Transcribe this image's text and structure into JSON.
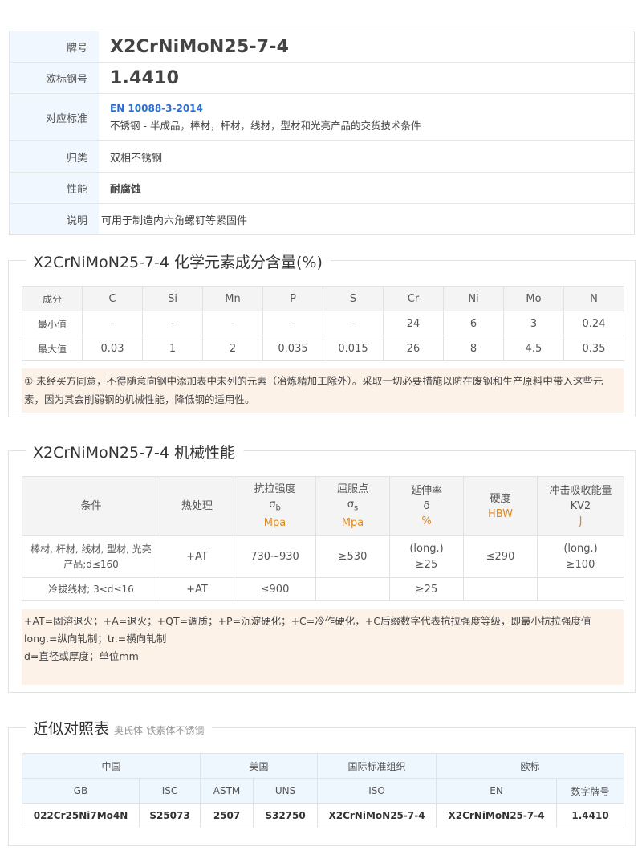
{
  "info": {
    "grade_label": "牌号",
    "grade_value": "X2CrNiMoN25-7-4",
    "eu_label": "欧标钢号",
    "eu_value": "1.4410",
    "std_label": "对应标准",
    "std_link": "EN 10088-3-2014",
    "std_desc": "不锈钢 - 半成品，棒材，杆材，线材，型材和光亮产品的交货技术条件",
    "class_label": "归类",
    "class_value": "双相不锈钢",
    "prop_label": "性能",
    "prop_value": "耐腐蚀",
    "desc_label": "说明",
    "desc_value": "可用于制造内六角螺钉等紧固件"
  },
  "chem": {
    "title": "X2CrNiMoN25-7-4 化学元素成分含量(%)",
    "headers": [
      "成分",
      "C",
      "Si",
      "Mn",
      "P",
      "S",
      "Cr",
      "Ni",
      "Mo",
      "N"
    ],
    "min_row": [
      "最小值",
      "-",
      "-",
      "-",
      "-",
      "-",
      "24",
      "6",
      "3",
      "0.24"
    ],
    "max_row": [
      "最大值",
      "0.03",
      "1",
      "2",
      "0.035",
      "0.015",
      "26",
      "8",
      "4.5",
      "0.35"
    ],
    "note": "① 未经买方同意，不得随意向钢中添加表中未列的元素（冶炼精加工除外）。采取一切必要措施以防在废钢和生产原料中带入这些元素，因为其会削弱钢的机械性能，降低钢的适用性。"
  },
  "mech": {
    "title": "X2CrNiMoN25-7-4 机械性能",
    "h_cond": "条件",
    "h_heat": "热处理",
    "h_tensile": "抗拉强度",
    "h_tensile_sym": "σ",
    "h_tensile_sub": "b",
    "h_tensile_unit": "Mpa",
    "h_yield": "屈服点",
    "h_yield_sym": "σ",
    "h_yield_sub": "s",
    "h_yield_unit": "Mpa",
    "h_elong": "延伸率",
    "h_elong_sym": "δ",
    "h_elong_unit": "%",
    "h_hard": "硬度",
    "h_hard_unit": "HBW",
    "h_impact": "冲击吸收能量",
    "h_impact_sym": "KV2",
    "h_impact_unit": "J",
    "r1_cond": "棒材, 杆材, 线材, 型材, 光亮产品;d≤160",
    "r1_heat": "+AT",
    "r1_tensile": "730~930",
    "r1_yield": "≥530",
    "r1_elong_a": "(long.)",
    "r1_elong_b": "≥25",
    "r1_hard": "≤290",
    "r1_impact_a": "(long.)",
    "r1_impact_b": "≥100",
    "r2_cond": "冷拔线材; 3<d≤16",
    "r2_heat": "+AT",
    "r2_tensile": "≤900",
    "r2_elong": "≥25",
    "note1": "+AT=固溶退火；+A=退火；+QT=调质；+P=沉淀硬化；+C=冷作硬化，+C后缀数字代表抗拉强度等级，即最小抗拉强度值",
    "note2": "long.=纵向轧制；tr.=横向轧制",
    "note3": "d=直径或厚度；单位mm"
  },
  "compare": {
    "title": "近似对照表",
    "subtitle": "奥氏体-铁素体不锈钢",
    "groups": [
      "中国",
      "美国",
      "国际标准组织",
      "欧标"
    ],
    "cols": [
      "GB",
      "ISC",
      "ASTM",
      "UNS",
      "ISO",
      "EN",
      "数字牌号"
    ],
    "row": [
      "022Cr25Ni7Mo4N",
      "S25073",
      "2507",
      "S32750",
      "X2CrNiMoN25-7-4",
      "X2CrNiMoN25-7-4",
      "1.4410"
    ]
  },
  "colors": {
    "label_bg": "#f0f7fe",
    "link": "#2a6fd6",
    "unit": "#e08a1e",
    "note_bg": "#fdf2e8",
    "compare_header_bg": "#eef6fe"
  }
}
